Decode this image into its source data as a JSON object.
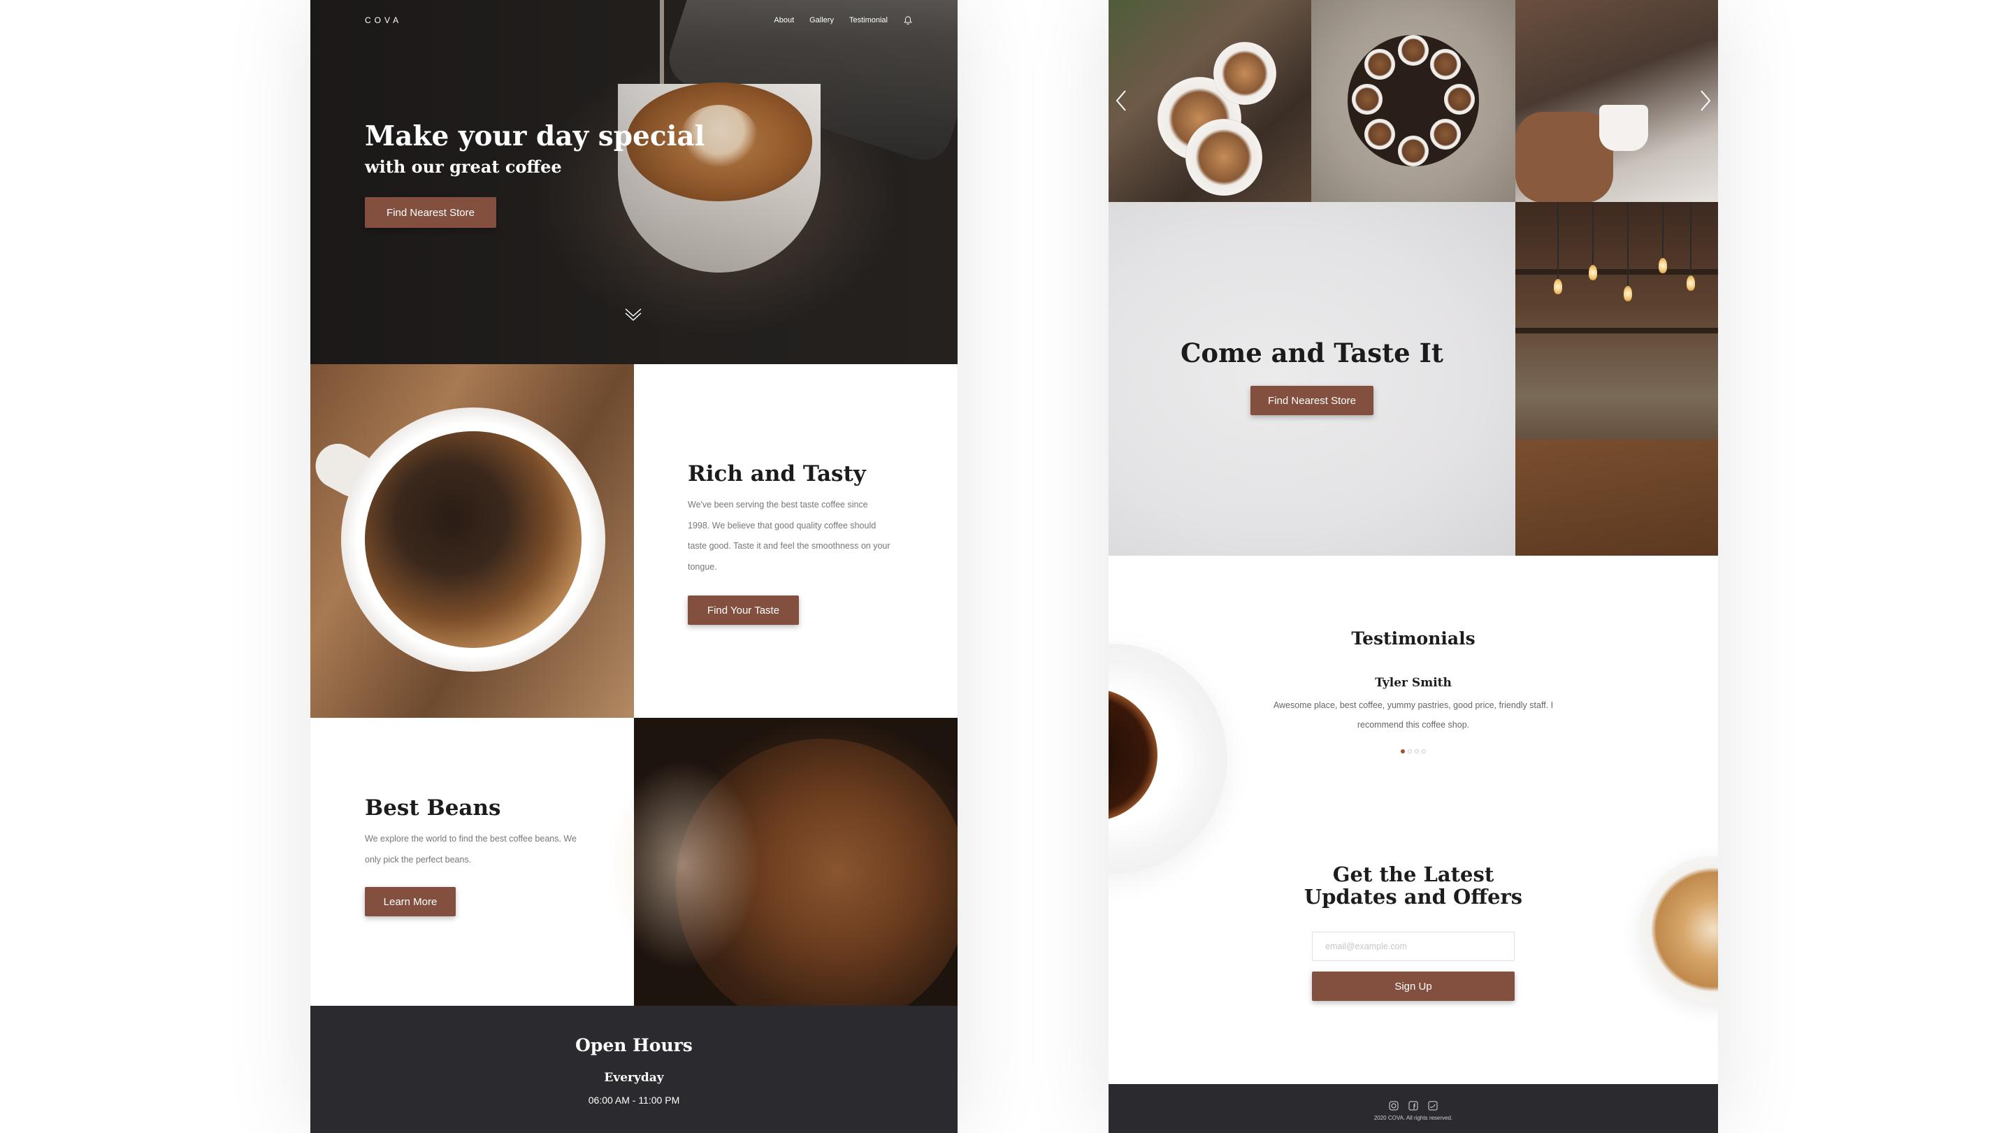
{
  "left": {
    "logo": "COVA",
    "nav": {
      "about": "About",
      "gallery": "Gallery",
      "testimonial": "Testimonial"
    },
    "hero": {
      "title": "Make your day special",
      "subtitle": "with our great coffee",
      "button": "Find Nearest Store"
    },
    "rich": {
      "title": "Rich and Tasty",
      "text": "We've been serving the best taste coffee since 1998. We believe that good quality coffee should taste good. Taste it and feel the smoothness on your tongue.",
      "button": "Find Your Taste"
    },
    "beans": {
      "title": "Best Beans",
      "text": "We explore the world to find the best coffee beans. We only pick the perfect beans.",
      "button": "Learn More"
    },
    "hours": {
      "title": "Open Hours",
      "day": "Everyday",
      "time": "06:00 AM - 11:00 PM"
    }
  },
  "right": {
    "cta": {
      "title": "Come and Taste It",
      "button": "Find Nearest Store"
    },
    "testimonials": {
      "title": "Testimonials",
      "name": "Tyler Smith",
      "quote": "Awesome place, best coffee, yummy pastries, good price, friendly staff. I recommend this coffee shop.",
      "active_index": 0,
      "count": 4
    },
    "newsletter": {
      "title_line1": "Get the Latest",
      "title_line2": "Updates and Offers",
      "placeholder": "email@example.com",
      "button": "Sign Up"
    },
    "footer": {
      "copyright": "2020 COVA. All rights reserved.",
      "socials": [
        "instagram-icon",
        "facebook-icon",
        "twitter-icon"
      ]
    }
  },
  "colors": {
    "accent": "#83503f",
    "dark": "#2b2b2f",
    "dot_active": "#a0522d"
  }
}
